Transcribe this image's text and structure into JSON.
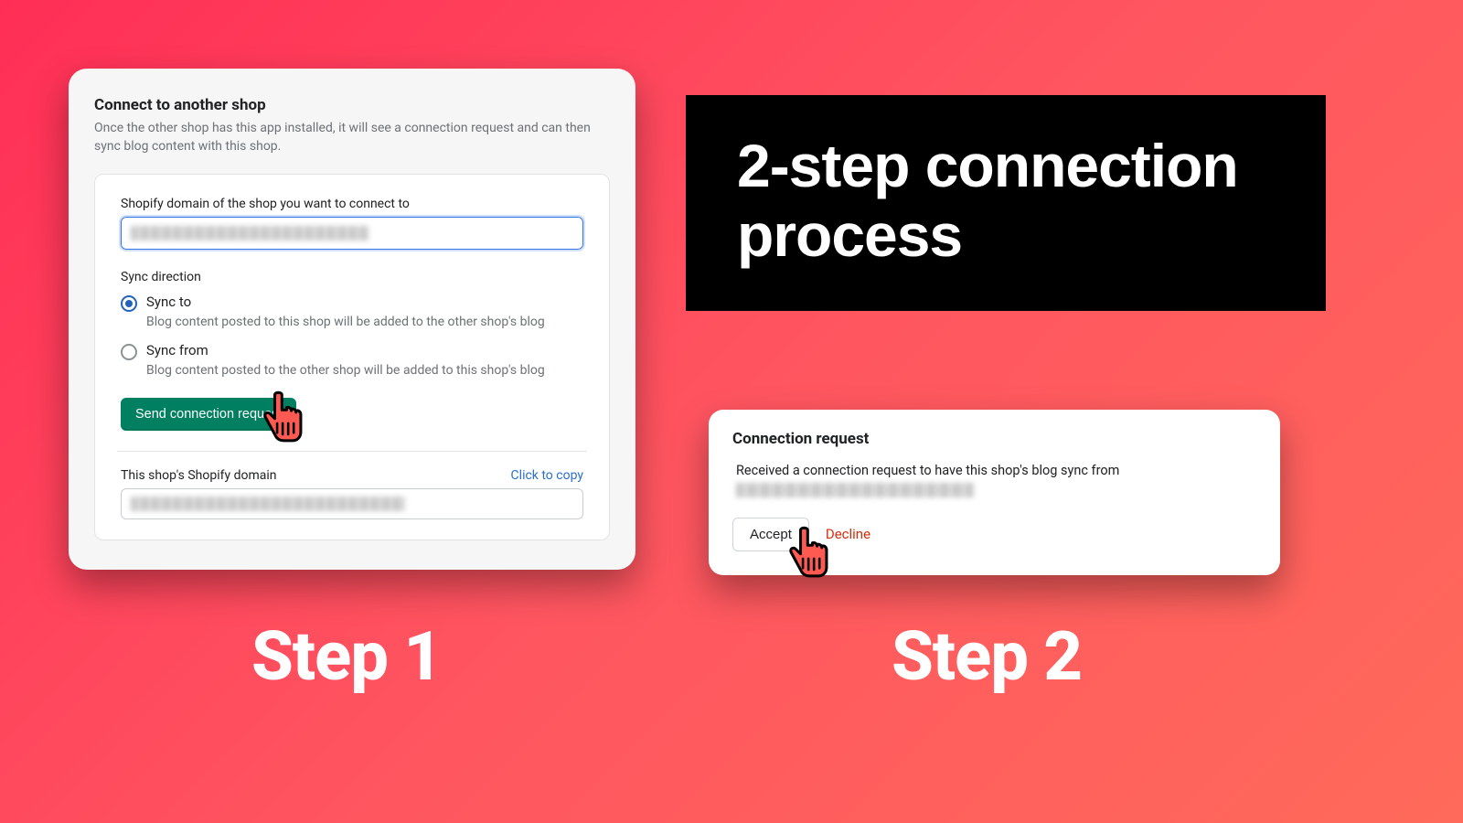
{
  "title_panel": {
    "heading": "2-step connection process"
  },
  "step_labels": {
    "step1": "Step 1",
    "step2": "Step 2"
  },
  "card1": {
    "title": "Connect to another shop",
    "subtitle": "Once the other shop has this app installed, it will see a connection request and can then sync blog content with this shop.",
    "domain_label": "Shopify domain of the shop you want to connect to",
    "sync_direction_label": "Sync direction",
    "sync_to": {
      "label": "Sync to",
      "desc": "Blog content posted to this shop will be added to the other shop's blog"
    },
    "sync_from": {
      "label": "Sync from",
      "desc": "Blog content posted to the other shop will be added to this shop's blog"
    },
    "send_button": "Send connection request",
    "this_domain_label": "This shop's Shopify domain",
    "copy_link": "Click to copy"
  },
  "card2": {
    "title": "Connection request",
    "message": "Received a connection request to have this shop's blog sync from",
    "accept": "Accept",
    "decline": "Decline"
  }
}
